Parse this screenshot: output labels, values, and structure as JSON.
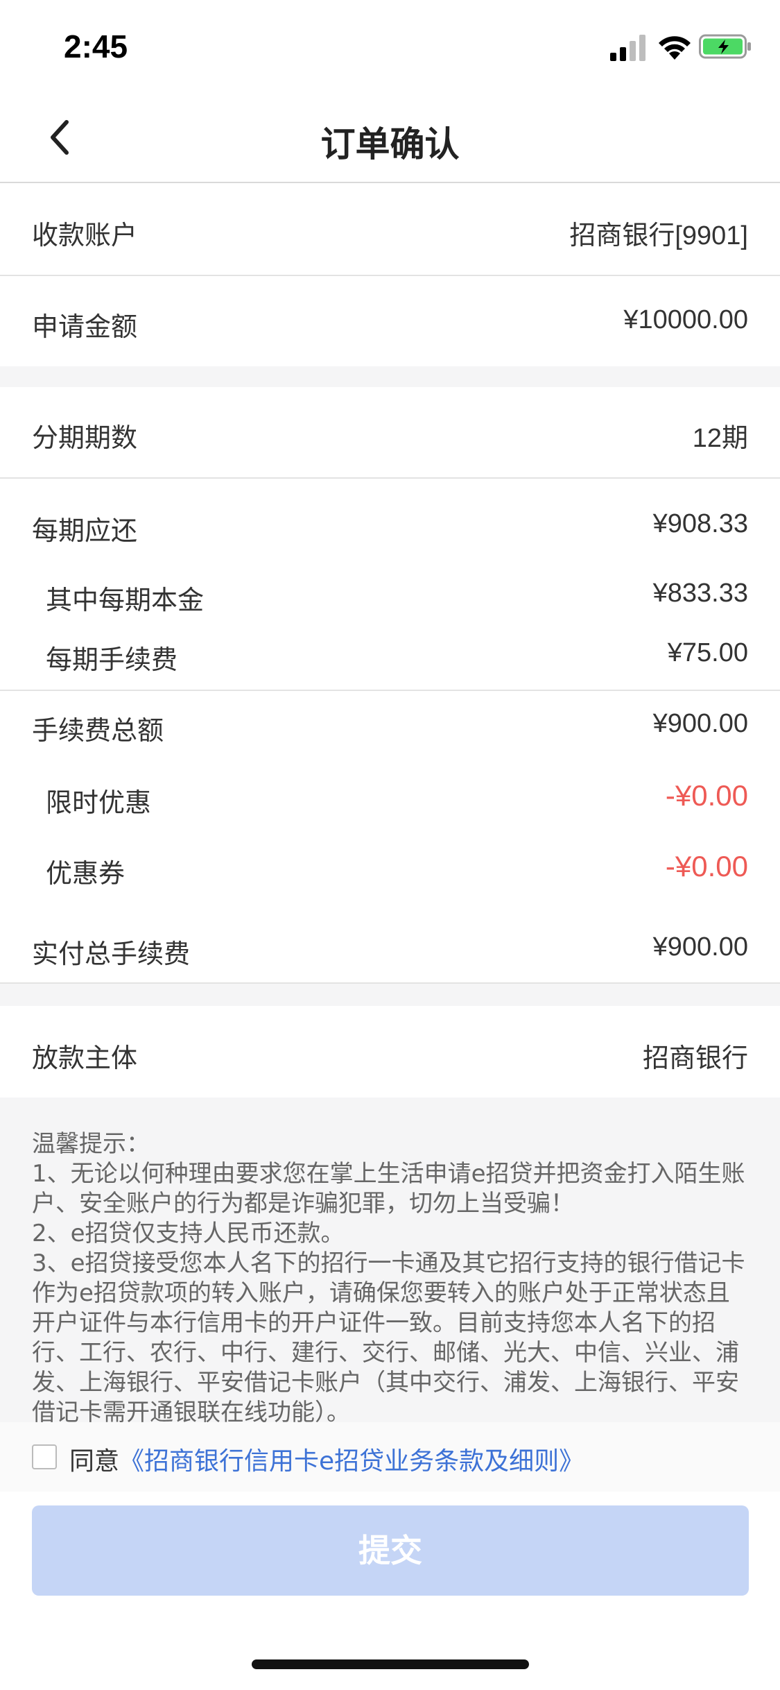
{
  "status_bar": {
    "time": "2:45",
    "icons": [
      "signal-icon",
      "wifi-icon",
      "battery-charging-icon"
    ],
    "battery_color": "#4cd964"
  },
  "nav": {
    "title": "订单确认",
    "back_icon": "chevron-left-icon"
  },
  "rows": {
    "account": {
      "label": "收款账户",
      "value": "招商银行[9901]"
    },
    "amount": {
      "label": "申请金额",
      "value": "¥10000.00"
    },
    "periods": {
      "label": "分期期数",
      "value": "12期"
    },
    "per_period": {
      "label": "每期应还",
      "value": "¥908.33"
    },
    "principal": {
      "label": "其中每期本金",
      "value": "¥833.33"
    },
    "fee_per_period": {
      "label": "每期手续费",
      "value": "¥75.00"
    },
    "fee_total": {
      "label": "手续费总额",
      "value": "¥900.00"
    },
    "limited_discount": {
      "label": "限时优惠",
      "value": "-¥0.00"
    },
    "coupon": {
      "label": "优惠券",
      "value": "-¥0.00"
    },
    "actual_fee": {
      "label": "实付总手续费",
      "value": "¥900.00"
    },
    "lender": {
      "label": "放款主体",
      "value": "招商银行"
    }
  },
  "notice": {
    "text": "温馨提示：\n1、无论以何种理由要求您在掌上生活申请e招贷并把资金打入陌生账户、安全账户的行为都是诈骗犯罪，切勿上当受骗！\n2、e招贷仅支持人民币还款。\n3、e招贷接受您本人名下的招行一卡通及其它招行支持的银行借记卡作为e招贷款项的转入账户，请确保您要转入的账户处于正常状态且开户证件与本行信用卡的开户证件一致。目前支持您本人名下的招行、工行、农行、中行、建行、交行、邮储、光大、中信、兴业、浦发、上海银行、平安借记卡账户（其中交行、浦发、上海银行、平安借记卡需开通银联在线功能）。"
  },
  "agreement": {
    "prefix": "同意",
    "link": "《招商银行信用卡e招贷业务条款及细则》",
    "checked": false
  },
  "submit": {
    "label": "提交"
  },
  "colors": {
    "accent_link": "#3d72d6",
    "discount_red": "#ee5a55",
    "submit_disabled": "#c5d5f6"
  }
}
